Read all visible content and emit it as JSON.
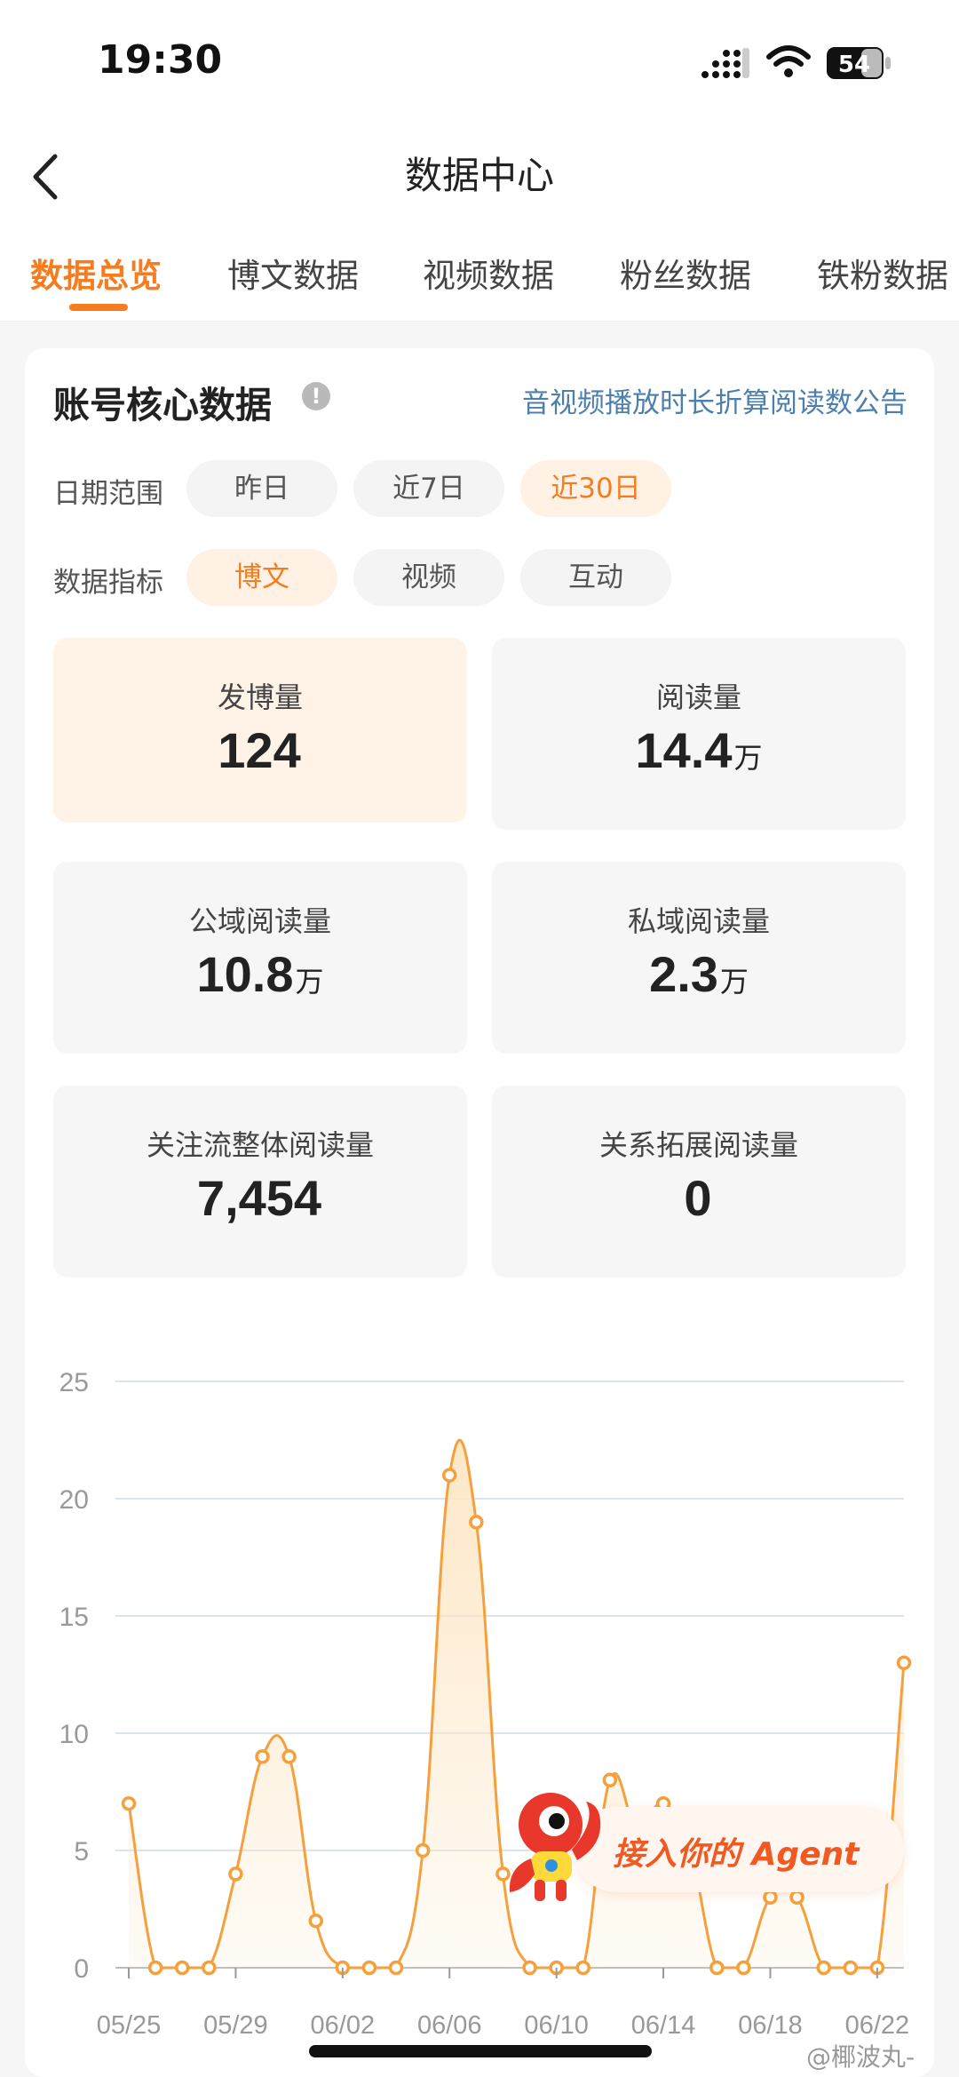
{
  "status_bar": {
    "time": "19:30",
    "battery": "54"
  },
  "nav": {
    "title": "数据中心"
  },
  "tabs": [
    {
      "label": "数据总览",
      "active": true
    },
    {
      "label": "博文数据",
      "active": false
    },
    {
      "label": "视频数据",
      "active": false
    },
    {
      "label": "粉丝数据",
      "active": false
    },
    {
      "label": "铁粉数据",
      "active": false
    }
  ],
  "card": {
    "title": "账号核心数据",
    "info_icon": "!",
    "notice_link": "音视频播放时长折算阅读数公告",
    "date_range": {
      "label": "日期范围",
      "options": [
        "昨日",
        "近7日",
        "近30日"
      ],
      "selected": "近30日"
    },
    "metric": {
      "label": "数据指标",
      "options": [
        "博文",
        "视频",
        "互动"
      ],
      "selected": "博文"
    },
    "stats": [
      {
        "label": "发博量",
        "value": "124",
        "unit": ""
      },
      {
        "label": "阅读量",
        "value": "14.4",
        "unit": "万"
      },
      {
        "label": "公域阅读量",
        "value": "10.8",
        "unit": "万"
      },
      {
        "label": "私域阅读量",
        "value": "2.3",
        "unit": "万"
      },
      {
        "label": "关注流整体阅读量",
        "value": "7,454",
        "unit": ""
      },
      {
        "label": "关系拓展阅读量",
        "value": "0",
        "unit": ""
      }
    ]
  },
  "chart_data": {
    "type": "area",
    "title": "",
    "xlabel": "",
    "ylabel": "",
    "ylim": [
      0,
      25
    ],
    "yticks": [
      0,
      5,
      10,
      15,
      20,
      25
    ],
    "x": [
      "05/25",
      "05/26",
      "05/27",
      "05/28",
      "05/29",
      "05/30",
      "05/31",
      "06/01",
      "06/02",
      "06/03",
      "06/04",
      "06/05",
      "06/06",
      "06/07",
      "06/08",
      "06/09",
      "06/10",
      "06/11",
      "06/12",
      "06/13",
      "06/14",
      "06/15",
      "06/16",
      "06/17",
      "06/18",
      "06/19",
      "06/20",
      "06/21",
      "06/22",
      "06/23"
    ],
    "xtick_labels": [
      "05/25",
      "05/29",
      "06/02",
      "06/06",
      "06/10",
      "06/14",
      "06/18",
      "06/22"
    ],
    "series": [
      {
        "values": [
          7,
          0,
          0,
          0,
          4,
          9,
          9,
          2,
          0,
          0,
          0,
          5,
          21,
          19,
          4,
          0,
          0,
          0,
          8,
          6,
          7,
          5,
          0,
          0,
          3,
          3,
          0,
          0,
          0,
          13
        ]
      }
    ],
    "colors": {
      "line": "#f5a03c",
      "fill": "#fde6c4",
      "grid": "#dce4ee"
    },
    "grid": true,
    "legend": "none"
  },
  "agent_banner": {
    "label": "接入你的 Agent"
  },
  "watermark": "@椰波丸-"
}
